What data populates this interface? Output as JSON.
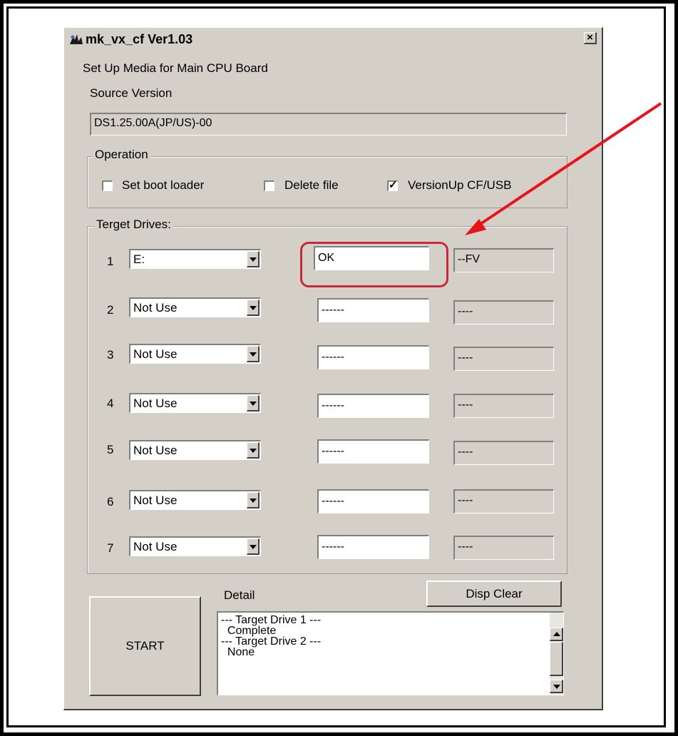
{
  "window": {
    "title": "mk_vx_cf Ver1.03",
    "close_label": "×"
  },
  "header": {
    "subtitle": "Set Up Media for Main CPU Board",
    "source_label": "Source Version",
    "source_value": "DS1.25.00A(JP/US)-00"
  },
  "operation": {
    "title": "Operation",
    "options": [
      {
        "label": "Set boot loader",
        "checked": false
      },
      {
        "label": "Delete file",
        "checked": false
      },
      {
        "label": "VersionUp CF/USB",
        "checked": true
      }
    ]
  },
  "targets": {
    "title": "Terget Drives:",
    "rows": [
      {
        "num": "1",
        "drive": "E:",
        "status": "OK",
        "info": "--FV"
      },
      {
        "num": "2",
        "drive": "Not Use",
        "status": "------",
        "info": "----"
      },
      {
        "num": "3",
        "drive": "Not Use",
        "status": "------",
        "info": "----"
      },
      {
        "num": "4",
        "drive": "Not Use",
        "status": "------",
        "info": "----"
      },
      {
        "num": "5",
        "drive": "Not Use",
        "status": "------",
        "info": "----"
      },
      {
        "num": "6",
        "drive": "Not Use",
        "status": "------",
        "info": "----"
      },
      {
        "num": "7",
        "drive": "Not Use",
        "status": "------",
        "info": "----"
      }
    ]
  },
  "bottom": {
    "start_label": "START",
    "detail_label": "Detail",
    "disp_clear_label": "Disp Clear",
    "detail_lines": [
      "--- Target Drive 1 ---",
      "  Complete",
      "--- Target Drive 2 ---",
      "  None"
    ]
  },
  "colors": {
    "highlight": "#c8283c",
    "arrow": "#e8141c",
    "window_bg": "#d4d0c8"
  }
}
